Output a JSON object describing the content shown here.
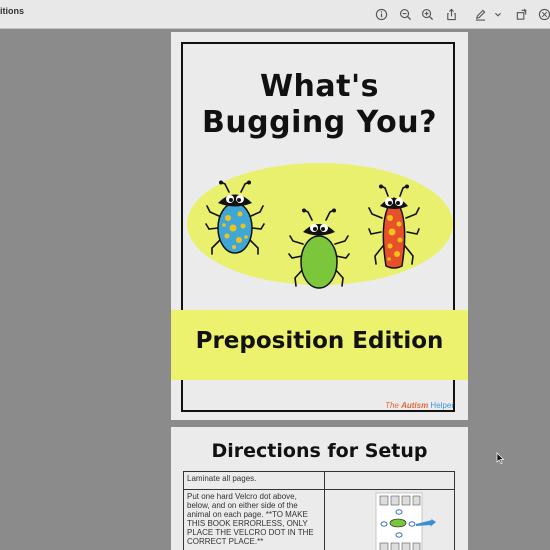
{
  "window": {
    "title": "itions"
  },
  "toolbar": {
    "buttons": [
      "info-icon",
      "zoom-out-icon",
      "zoom-in-icon",
      "share-icon",
      "markup-icon",
      "chevron-down-icon",
      "rotate-icon",
      "search-icon"
    ]
  },
  "page1": {
    "title_line1": "What's",
    "title_line2": "Bugging You?",
    "edition": "Preposition Edition",
    "brand_part1": "The ",
    "brand_part2": "Autism",
    "brand_part3": " Helper"
  },
  "page2": {
    "heading": "Directions for Setup",
    "rows": [
      {
        "text": "Laminate all pages."
      },
      {
        "text": "Put one hard Velcro dot above, below, and on either side of the animal on each page. **TO MAKE THIS BOOK ERRORLESS, ONLY PLACE THE VELCRO DOT IN THE CORRECT PLACE.**"
      }
    ]
  },
  "colors": {
    "highlight_yellow": "#ecf26d",
    "bug_blue": "#3fa7d6",
    "bug_green": "#7bc63a",
    "bug_red": "#e8502a"
  }
}
